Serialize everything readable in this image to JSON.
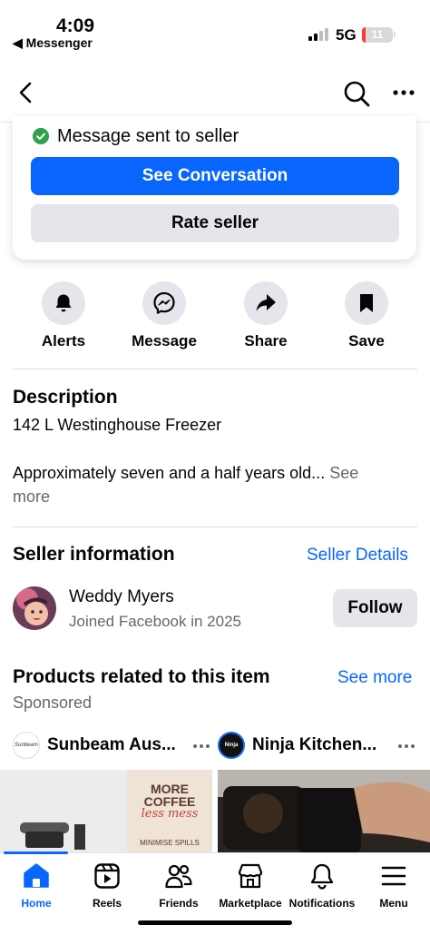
{
  "status_bar": {
    "time": "4:09",
    "back_app": "◀ Messenger",
    "network": "5G",
    "battery": "11",
    "battery_level": 0.11
  },
  "nav": {
    "back_icon": "chevron-left-icon",
    "search_icon": "search-icon",
    "more_icon": "more-icon"
  },
  "message_card": {
    "status_text": "Message sent to seller",
    "see_conversation_label": "See Conversation",
    "rate_seller_label": "Rate seller"
  },
  "actions": [
    {
      "label": "Alerts",
      "icon": "bell-icon"
    },
    {
      "label": "Message",
      "icon": "messenger-icon"
    },
    {
      "label": "Share",
      "icon": "share-icon"
    },
    {
      "label": "Save",
      "icon": "bookmark-icon"
    }
  ],
  "description": {
    "title": "Description",
    "listing_title": "142 L Westinghouse Freezer",
    "body": "Approximately seven and a half years old...",
    "see_more_part1": " See",
    "see_more_part2": "more"
  },
  "seller": {
    "title": "Seller information",
    "details_link": "Seller Details",
    "name": "Weddy Myers",
    "joined": "Joined Facebook in 2025",
    "follow_label": "Follow"
  },
  "related": {
    "title": "Products related to this item",
    "see_more": "See more",
    "sponsored": "Sponsored",
    "products": [
      {
        "brand": "Sunbeam Aus...",
        "logo_text": "Sunbeam",
        "image_text_1": "MORE",
        "image_text_2": "COFFEE",
        "image_text_3": "less mess",
        "image_text_4": "MINIMISE SPILLS"
      },
      {
        "brand": "Ninja Kitchen...",
        "logo_text": "Ninja"
      }
    ]
  },
  "tab_bar": {
    "tabs": [
      {
        "label": "Home",
        "icon": "home-icon",
        "active": true
      },
      {
        "label": "Reels",
        "icon": "reels-icon",
        "active": false
      },
      {
        "label": "Friends",
        "icon": "friends-icon",
        "active": false
      },
      {
        "label": "Marketplace",
        "icon": "marketplace-icon",
        "active": false
      },
      {
        "label": "Notifications",
        "icon": "bell-icon",
        "active": false
      },
      {
        "label": "Menu",
        "icon": "menu-icon",
        "active": false
      }
    ]
  },
  "colors": {
    "accent": "#0866ff",
    "success": "#31a24c",
    "secondary_text": "#65676b",
    "button_gray": "#e4e6eb"
  }
}
